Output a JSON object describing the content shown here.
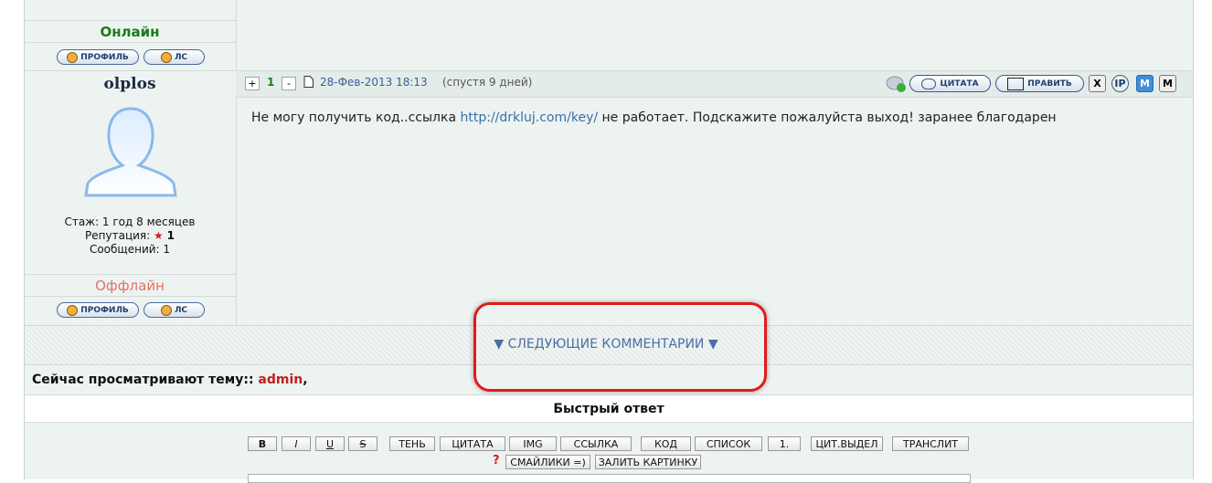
{
  "user1": {
    "status": "Онлайн",
    "profile_label": "ПРОФИЛЬ",
    "pm_label": "ЛС"
  },
  "post": {
    "vote_plus": "+",
    "vote_count": "1",
    "vote_minus": "-",
    "date": "28-Фев-2013 18:13",
    "after": "(спустя 9 дней)",
    "quote_label": "ЦИТАТА",
    "edit_label": "ПРАВИТЬ",
    "x_label": "X",
    "ip_label": "IP",
    "m_label": "M",
    "text_before": "Не могу получить код..ссылка",
    "link": "http://drkluj.com/key/",
    "text_after": "не работает. Подскажите пожалуйста выход! заранее благодарен"
  },
  "user2": {
    "name": "olplos",
    "tenure": "Стаж: 1 год 8 месяцев",
    "reputation_label": "Репутация:",
    "reputation_star": "★",
    "reputation_value": "1",
    "messages": "Сообщений: 1",
    "status": "Оффлайн",
    "profile_label": "ПРОФИЛЬ",
    "pm_label": "ЛС"
  },
  "next_comments": "▼ СЛЕДУЮЩИЕ КОММЕНТАРИИ ▼",
  "viewers": {
    "label": "Сейчас просматривают тему::",
    "user": "admin",
    "sep": ","
  },
  "quick_reply": {
    "title": "Быстрый ответ",
    "buttons": [
      "B",
      "I",
      "U",
      "S",
      "ТЕНЬ",
      "ЦИТАТА",
      "IMG",
      "ССЫЛКА",
      "КОД",
      "СПИСОК",
      "1.",
      "ЦИТ.ВЫДЕЛ",
      "ТРАНСЛИТ"
    ],
    "help": "?",
    "smilies": "СМАЙЛИКИ =)",
    "upload": "ЗАЛИТЬ КАРТИНКУ"
  },
  "colors": {
    "online": "#1c7a1c",
    "offline": "#e57068",
    "link": "#3a6ea8",
    "highlight": "#e31a1a"
  },
  "icons": [
    "profile-icon",
    "pm-icon",
    "post-icon",
    "comment-status-icon",
    "quote-icon",
    "edit-icon",
    "avatar-silhouette-icon",
    "star-icon"
  ]
}
